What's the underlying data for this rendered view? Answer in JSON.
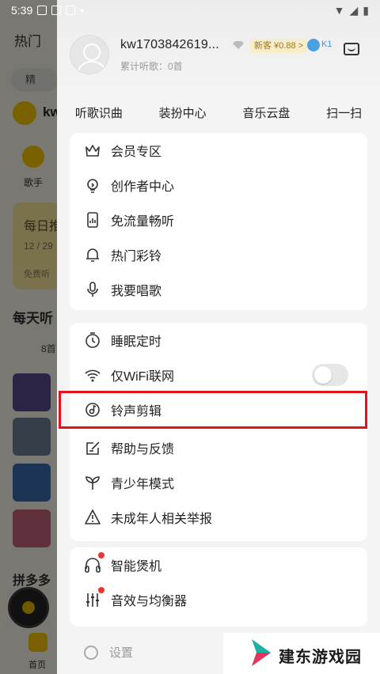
{
  "status_bar": {
    "time": "5:39"
  },
  "background_app": {
    "hot_label": "热门",
    "search_placeholder": "精",
    "brand_label": "kw",
    "singer_label": "歌手",
    "daily_title": "每日推",
    "daily_date": "12 / 29",
    "daily_sub": "免费听",
    "daily_listen_title": "每天听",
    "count_label": "8首",
    "pinduoduo_label": "拼多多",
    "home_tab": "首页"
  },
  "profile": {
    "username": "kw1703842619...",
    "vip_badge": "新客 ¥0.88 >",
    "level_badge": "K1",
    "listen_count": "累计听歌：0首"
  },
  "quick_actions": [
    {
      "label": "听歌识曲"
    },
    {
      "label": "装扮中心"
    },
    {
      "label": "音乐云盘"
    },
    {
      "label": "扫一扫"
    }
  ],
  "menu_group_1": [
    {
      "label": "会员专区",
      "icon": "crown-icon"
    },
    {
      "label": "创作者中心",
      "icon": "lightbulb-icon"
    },
    {
      "label": "免流量畅听",
      "icon": "phone-data-icon"
    },
    {
      "label": "热门彩铃",
      "icon": "bell-icon"
    },
    {
      "label": "我要唱歌",
      "icon": "microphone-icon"
    }
  ],
  "menu_group_2": [
    {
      "label": "睡眠定时",
      "icon": "timer-icon"
    },
    {
      "label": "仅WiFi联网",
      "icon": "wifi-icon",
      "toggle": false
    },
    {
      "label": "铃声剪辑",
      "icon": "ringtone-edit-icon",
      "highlighted": true
    },
    {
      "label": "帮助与反馈",
      "icon": "feedback-icon"
    },
    {
      "label": "青少年模式",
      "icon": "sprout-icon"
    },
    {
      "label": "未成年人相关举报",
      "icon": "warning-icon"
    }
  ],
  "menu_group_3": [
    {
      "label": "智能煲机",
      "icon": "headphones-icon",
      "badge_dot": true
    },
    {
      "label": "音效与均衡器",
      "icon": "equalizer-icon",
      "badge_dot": true
    }
  ],
  "footer": {
    "settings_label": "设置"
  },
  "watermark": {
    "text": "建东游戏园"
  },
  "colors": {
    "highlight_border": "#e0141a",
    "badge_dot": "#e33333",
    "brand_yellow": "#f3c200"
  }
}
